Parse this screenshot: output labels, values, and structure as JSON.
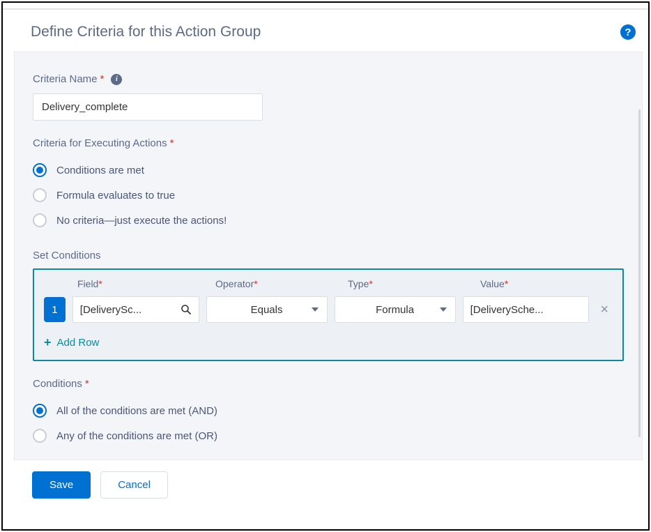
{
  "header": {
    "title": "Define Criteria for this Action Group"
  },
  "criteriaName": {
    "label": "Criteria Name",
    "value": "Delivery_complete"
  },
  "criteriaExec": {
    "label": "Criteria for Executing Actions",
    "options": [
      "Conditions are met",
      "Formula evaluates to true",
      "No criteria—just execute the actions!"
    ],
    "selectedIndex": 0
  },
  "setConditions": {
    "label": "Set Conditions",
    "columns": {
      "field": "Field",
      "operator": "Operator",
      "type": "Type",
      "value": "Value"
    },
    "rows": [
      {
        "num": "1",
        "field": "[DeliverySc...",
        "operator": "Equals",
        "type": "Formula",
        "value": "[DeliverySche..."
      }
    ],
    "addRow": "Add Row"
  },
  "conditionsLogic": {
    "label": "Conditions",
    "options": [
      "All of the conditions are met (AND)",
      "Any of the conditions are met (OR)"
    ],
    "selectedIndex": 0
  },
  "footer": {
    "save": "Save",
    "cancel": "Cancel"
  }
}
